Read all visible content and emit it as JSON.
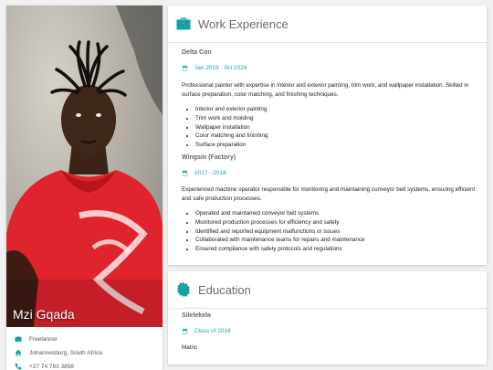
{
  "profile": {
    "name": "Mzi Gqada",
    "info": [
      {
        "icon": "briefcase-icon",
        "text": "Freelancer"
      },
      {
        "icon": "home-icon",
        "text": "Johannesburg, South Africa"
      },
      {
        "icon": "phone-icon",
        "text": "+27 74 783 3856"
      }
    ]
  },
  "work": {
    "title": "Work Experience",
    "icon": "briefcase-icon",
    "jobs": [
      {
        "company": "Delta Con",
        "date": "Jan 2019 - 0ct 2024",
        "description": "Professional painter with expertise in interior and exterior painting, trim work, and wallpaper installation. Skilled in surface preparation, color matching, and finishing techniques.",
        "bullets": [
          "Interior and exterior painting",
          "Trim work and molding",
          "Wallpaper installation",
          "Color matching and finishing",
          "Surface preparation"
        ]
      },
      {
        "company": "Wingsin (Factory)",
        "date": "2017 - 2018",
        "description": "Experienced machine operator responsible for monitoring and maintaining conveyor belt systems, ensuring efficient and safe production processes.",
        "bullets": [
          "Operated and maintained conveyor belt systems",
          "Monitored production processes for efficiency and safety",
          "Identified and reported equipment malfunctions or issues",
          "Collaborated with maintenance teams for repairs and maintenance",
          "Ensured compliance with safety protocols and regulations"
        ]
      }
    ]
  },
  "education": {
    "title": "Education",
    "icon": "certificate-icon",
    "school": "Silelekela",
    "date": "Class of 2016",
    "qualification": "Matric"
  },
  "colors": {
    "accent": "#17a2a2",
    "background": "#f1f1f1",
    "shirt": "#e0242e"
  }
}
